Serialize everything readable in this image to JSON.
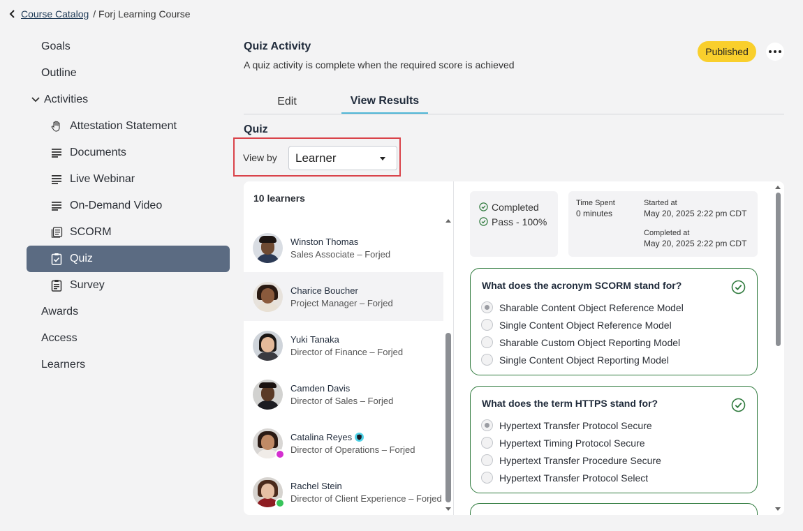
{
  "breadcrumb": {
    "back_icon": "chevron-left-icon",
    "link": "Course Catalog",
    "current": "/ Forj Learning Course"
  },
  "sidebar": {
    "goals": "Goals",
    "outline": "Outline",
    "activities": "Activities",
    "items": [
      {
        "label": "Attestation Statement",
        "icon": "hand-icon"
      },
      {
        "label": "Documents",
        "icon": "lines-icon"
      },
      {
        "label": "Live Webinar",
        "icon": "lines-icon"
      },
      {
        "label": "On-Demand Video",
        "icon": "lines-icon"
      },
      {
        "label": "SCORM",
        "icon": "scorm-icon"
      },
      {
        "label": "Quiz",
        "icon": "clipboard-check-icon"
      },
      {
        "label": "Survey",
        "icon": "clipboard-list-icon"
      }
    ],
    "awards": "Awards",
    "access": "Access",
    "learners": "Learners"
  },
  "header": {
    "title": "Quiz Activity",
    "subtitle": "A quiz activity is complete when the required score is achieved",
    "status": "Published"
  },
  "tabs": {
    "edit": "Edit",
    "results": "View Results"
  },
  "quiz_label": "Quiz",
  "view_by": {
    "label": "View by",
    "value": "Learner"
  },
  "learners": {
    "count": "10 learners",
    "list": [
      {
        "name": "Winston Thomas",
        "role": "Sales Associate – Forjed"
      },
      {
        "name": "Charice Boucher",
        "role": "Project Manager – Forjed"
      },
      {
        "name": "Yuki Tanaka",
        "role": "Director of Finance – Forjed"
      },
      {
        "name": "Camden Davis",
        "role": "Director of Sales – Forjed"
      },
      {
        "name": "Catalina Reyes",
        "role": "Director of Operations – Forjed"
      },
      {
        "name": "Rachel Stein",
        "role": "Director of Client Experience – Forjed"
      }
    ]
  },
  "result": {
    "status": "Completed",
    "score": "Pass - 100%",
    "time_spent_label": "Time Spent",
    "time_spent": "0 minutes",
    "started_label": "Started at",
    "started": "May 20, 2025 2:22 pm CDT",
    "completed_label": "Completed at",
    "completed": "May 20, 2025 2:22 pm CDT"
  },
  "questions": [
    {
      "text": "What does the acronym SCORM stand for?",
      "options": [
        "Sharable Content Object Reference Model",
        "Single Content Object Reference Model",
        "Sharable Custom Object Reporting Model",
        "Single Content Object Reporting Model"
      ]
    },
    {
      "text": "What does the term HTTPS stand for?",
      "options": [
        "Hypertext Transfer Protocol Secure",
        "Hypertext Timing Protocol Secure",
        "Hypertext Transfer Procedure Secure",
        "Hypertext Transfer Protocol Select"
      ]
    }
  ],
  "colors": {
    "accent": "#4fb6d6",
    "published": "#f9cf2c",
    "correct": "#2f7a3d",
    "active_nav": "#5b6b82",
    "highlight": "#d9434a"
  }
}
